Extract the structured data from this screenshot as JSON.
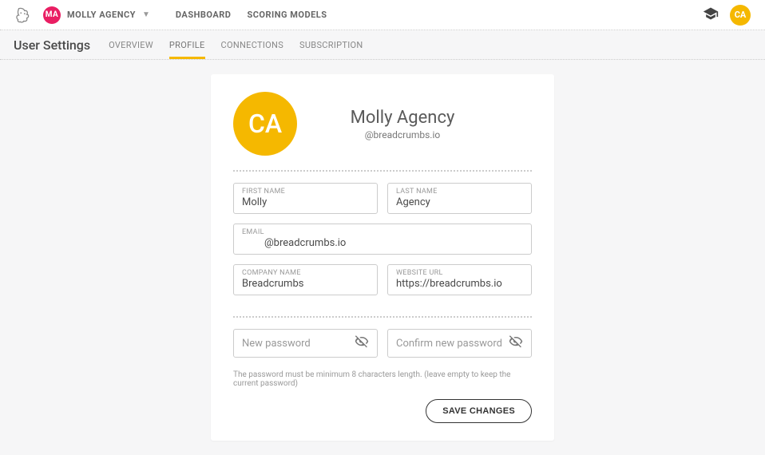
{
  "topNav": {
    "accountInitials": "MA",
    "accountName": "MOLLY AGENCY",
    "links": [
      "DASHBOARD",
      "SCORING MODELS"
    ],
    "userInitials": "CA"
  },
  "subBar": {
    "title": "User Settings",
    "tabs": [
      "OVERVIEW",
      "PROFILE",
      "CONNECTIONS",
      "SUBSCRIPTION"
    ],
    "activeTab": "PROFILE"
  },
  "profile": {
    "avatarInitials": "CA",
    "displayName": "Molly Agency",
    "handle": "@breadcrumbs.io",
    "fields": {
      "firstName": {
        "label": "FIRST NAME",
        "value": "Molly"
      },
      "lastName": {
        "label": "LAST NAME",
        "value": "Agency"
      },
      "email": {
        "label": "EMAIL",
        "value": "@breadcrumbs.io"
      },
      "companyName": {
        "label": "COMPANY NAME",
        "value": "Breadcrumbs"
      },
      "websiteUrl": {
        "label": "WEBSITE URL",
        "value": "https://breadcrumbs.io"
      },
      "newPassword": {
        "placeholder": "New password"
      },
      "confirmPassword": {
        "placeholder": "Confirm new password"
      }
    },
    "passwordHelper": "The password must be minimum 8 characters length. (leave empty to keep the current password)",
    "saveLabel": "SAVE CHANGES"
  }
}
